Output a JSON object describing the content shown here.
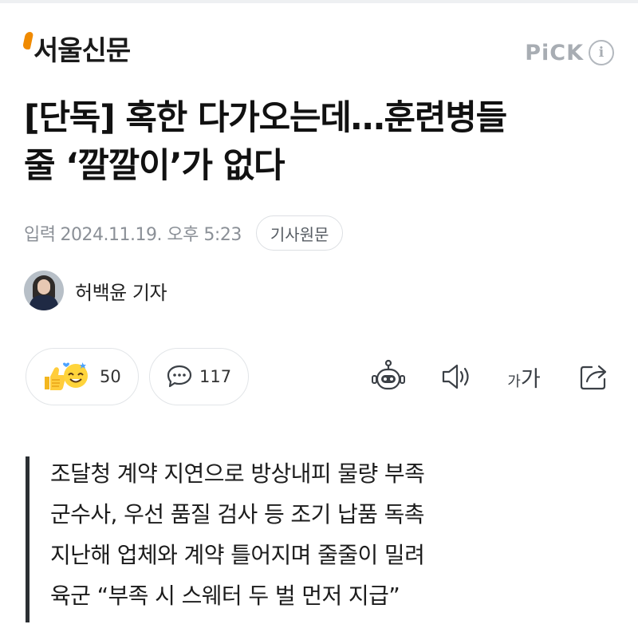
{
  "header": {
    "press_name": "서울신문",
    "pick_label": "PiCK",
    "info_icon_glyph": "i"
  },
  "article": {
    "title_line1": "[단독] 혹한 다가오는데…훈련병들",
    "title_line2": "줄 ‘깔깔이’가 없다",
    "date_prefix": "입력",
    "date": "2024.11.19. 오후 5:23",
    "original_button": "기사원문",
    "reporter": "허백윤 기자"
  },
  "toolbar": {
    "reaction_count": "50",
    "comment_count": "117",
    "font_small": "가",
    "font_large": "가",
    "icons": [
      "thumbs-up-icon",
      "smile-emoji-icon",
      "comment-icon",
      "bot-icon",
      "speaker-icon",
      "font-size-icon",
      "share-icon"
    ]
  },
  "summary": [
    "조달청 계약 지연으로 방상내피 물량 부족",
    "군수사, 우선 품질 검사 등 조기 납품 독촉",
    "지난해 업체와 계약 틀어지며 줄줄이 밀려",
    "육군 “부족 시 스웨터 두 벌 먼저 지급”"
  ],
  "colors": {
    "brand_accent": "#f08a00",
    "muted_text": "#8b9097",
    "pick_gray": "#a8adb3",
    "summary_bar": "#2b2f33"
  }
}
